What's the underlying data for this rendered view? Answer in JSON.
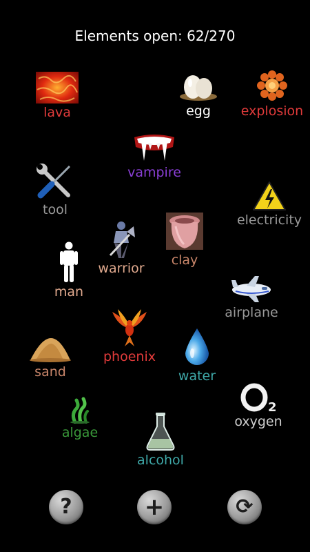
{
  "header": {
    "title": "Elements open: 62/270"
  },
  "elements": {
    "lava": {
      "label": "lava",
      "color": "#e23b3b",
      "icon": "lava-icon"
    },
    "egg": {
      "label": "egg",
      "color": "#ffffff",
      "icon": "egg-icon"
    },
    "explosion": {
      "label": "explosion",
      "color": "#e23b3b",
      "icon": "explosion-icon"
    },
    "vampire": {
      "label": "vampire",
      "color": "#8a3fd6",
      "icon": "vampire-fangs-icon"
    },
    "tool": {
      "label": "tool",
      "color": "#9a9a9a",
      "icon": "wrench-screwdriver-icon"
    },
    "electricity": {
      "label": "electricity",
      "color": "#9a9a9a",
      "icon": "high-voltage-sign-icon"
    },
    "warrior": {
      "label": "warrior",
      "color": "#e0a98e",
      "icon": "warrior-icon"
    },
    "clay": {
      "label": "clay",
      "color": "#c9866a",
      "icon": "clay-pot-icon"
    },
    "man": {
      "label": "man",
      "color": "#e0a98e",
      "icon": "man-figure-icon"
    },
    "airplane": {
      "label": "airplane",
      "color": "#9a9a9a",
      "icon": "airplane-icon"
    },
    "phoenix": {
      "label": "phoenix",
      "color": "#e23b3b",
      "icon": "phoenix-icon"
    },
    "sand": {
      "label": "sand",
      "color": "#c9866a",
      "icon": "sand-pile-icon"
    },
    "water": {
      "label": "water",
      "color": "#3fa9a9",
      "icon": "water-drop-icon"
    },
    "oxygen": {
      "label": "oxygen",
      "color": "#cfcfcf",
      "icon": "o2-icon"
    },
    "algae": {
      "label": "algae",
      "color": "#3a9a3a",
      "icon": "algae-icon"
    },
    "alcohol": {
      "label": "alcohol",
      "color": "#3fa9a9",
      "icon": "flask-icon"
    }
  },
  "toolbar": {
    "help": {
      "glyph": "?",
      "icon": "help-icon"
    },
    "add": {
      "glyph": "+",
      "icon": "plus-icon"
    },
    "reset": {
      "glyph": "⟳",
      "icon": "reset-icon"
    }
  }
}
